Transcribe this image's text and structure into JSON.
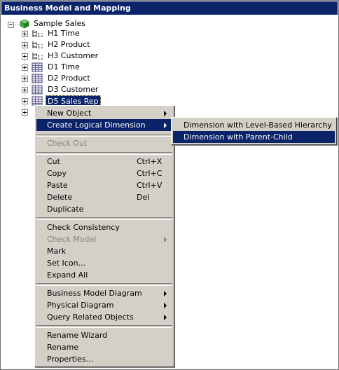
{
  "window": {
    "title": "Business Model and Mapping"
  },
  "tree": {
    "root": {
      "label": "Sample Sales",
      "icon": "business-model-cube-icon"
    },
    "children": [
      {
        "label": "H1 Time",
        "icon": "hierarchy-icon"
      },
      {
        "label": "H2 Product",
        "icon": "hierarchy-icon"
      },
      {
        "label": "H3 Customer",
        "icon": "hierarchy-icon"
      },
      {
        "label": "D1 Time",
        "icon": "table-icon"
      },
      {
        "label": "D2 Product",
        "icon": "table-icon"
      },
      {
        "label": "D3 Customer",
        "icon": "table-icon"
      },
      {
        "label": "D5 Sales Rep",
        "icon": "table-icon",
        "selected": true
      }
    ]
  },
  "context_menu": {
    "items": [
      {
        "label": "New Object",
        "submenu": true
      },
      {
        "label": "Create Logical Dimension",
        "submenu": true,
        "highlighted": true
      },
      {
        "separator": true
      },
      {
        "label": "Check Out",
        "disabled": true
      },
      {
        "separator": true
      },
      {
        "label": "Cut",
        "shortcut": "Ctrl+X"
      },
      {
        "label": "Copy",
        "shortcut": "Ctrl+C"
      },
      {
        "label": "Paste",
        "shortcut": "Ctrl+V"
      },
      {
        "label": "Delete",
        "shortcut": "Del"
      },
      {
        "label": "Duplicate"
      },
      {
        "separator": true
      },
      {
        "label": "Check Consistency"
      },
      {
        "label": "Check Model",
        "submenu": true,
        "disabled": true
      },
      {
        "label": "Mark"
      },
      {
        "label": "Set Icon..."
      },
      {
        "label": "Expand All"
      },
      {
        "separator": true
      },
      {
        "label": "Business Model Diagram",
        "submenu": true
      },
      {
        "label": "Physical Diagram",
        "submenu": true
      },
      {
        "label": "Query Related Objects",
        "submenu": true
      },
      {
        "separator": true
      },
      {
        "label": "Rename Wizard"
      },
      {
        "label": "Rename"
      },
      {
        "label": "Properties..."
      }
    ]
  },
  "submenu": {
    "items": [
      {
        "label": "Dimension with Level-Based Hierarchy"
      },
      {
        "label": "Dimension with Parent-Child Hierarchy...",
        "highlighted": true
      }
    ]
  },
  "colors": {
    "title_bg": "#0a246a",
    "menu_bg": "#d4d0c8",
    "highlight": "#0a246a"
  }
}
